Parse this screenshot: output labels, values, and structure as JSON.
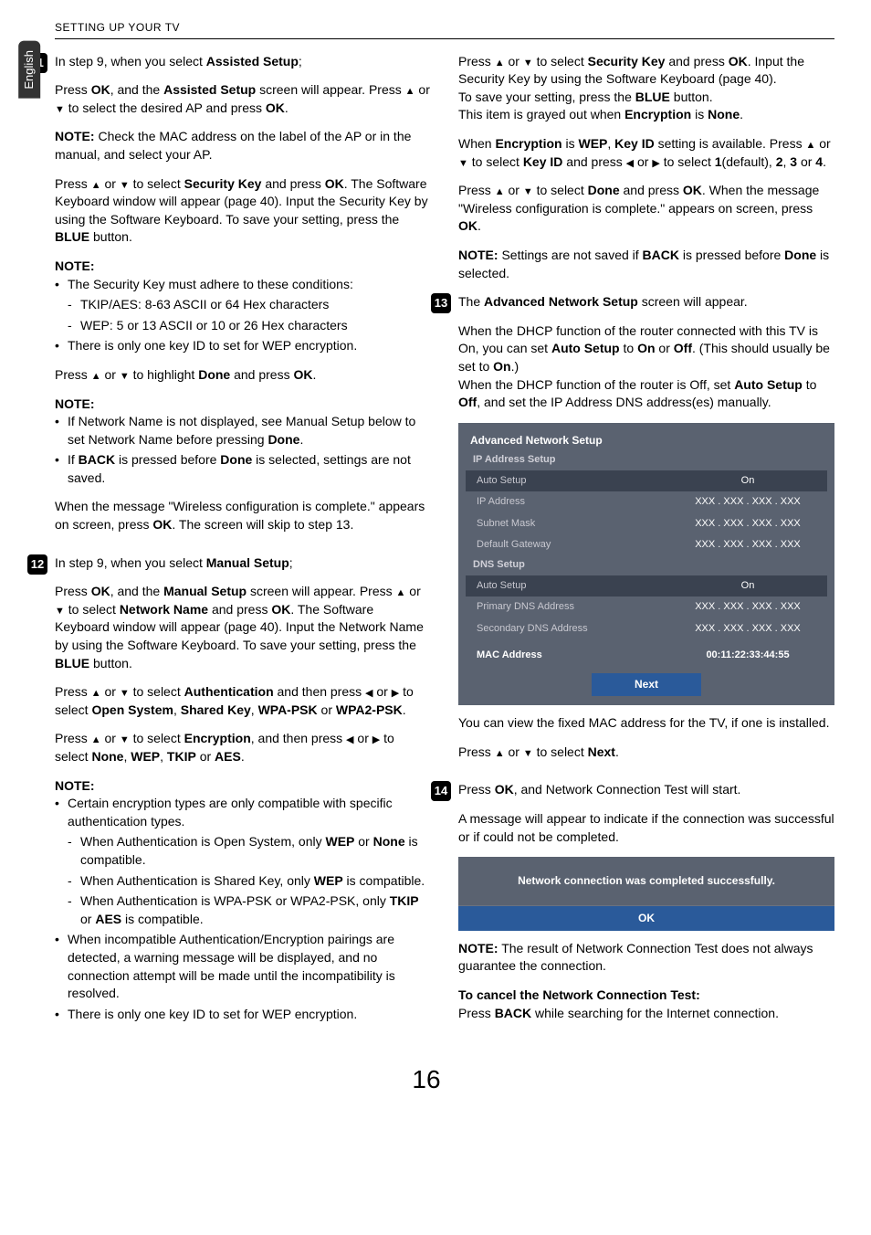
{
  "header": "SETTING UP YOUR TV",
  "langTab": "English",
  "pageNumber": "16",
  "steps": {
    "s11": "11",
    "s12": "12",
    "s13": "13",
    "s14": "14"
  },
  "col1": {
    "p1a": "In step 9, when you select ",
    "p1b": "Assisted Setup",
    "p1c": ";",
    "p2a": "Press ",
    "p2b": "OK",
    "p2c": ", and the ",
    "p2d": "Assisted Setup",
    "p2e": " screen will appear. Press ",
    "p2f": " or ",
    "p2g": " to select the desired AP and press ",
    "p2h": "OK",
    "p2i": ".",
    "p3a": "NOTE:",
    "p3b": " Check the MAC address on the label of the AP or in the manual, and select your AP.",
    "p4a": "Press ",
    "p4b": " or ",
    "p4c": " to select ",
    "p4d": "Security Key",
    "p4e": " and press ",
    "p4f": "OK",
    "p4g": ". The Software Keyboard window will appear (page 40). Input the Security Key by using the Software Keyboard. To save your setting, press the ",
    "p4h": "BLUE",
    "p4i": " button.",
    "note1": "NOTE:",
    "n1li1": "The Security Key must adhere to these conditions:",
    "n1s1": "TKIP/AES: 8-63 ASCII or 64 Hex characters",
    "n1s2": "WEP: 5 or 13 ASCII or 10 or 26 Hex characters",
    "n1li2": "There is only one key ID to set for WEP encryption.",
    "p5a": "Press ",
    "p5b": " or ",
    "p5c": " to highlight ",
    "p5d": "Done",
    "p5e": " and press ",
    "p5f": "OK",
    "p5g": ".",
    "note2": "NOTE:",
    "n2li1a": "If Network Name is not displayed, see Manual Setup below to set Network Name before pressing ",
    "n2li1b": "Done",
    "n2li1c": ".",
    "n2li2a": "If ",
    "n2li2b": "BACK",
    "n2li2c": " is pressed before ",
    "n2li2d": "Done",
    "n2li2e": " is selected, settings are not saved.",
    "p6a": "When the message \"Wireless configuration is complete.\" appears on screen, press ",
    "p6b": "OK",
    "p6c": ". The screen will skip to step 13.",
    "p7a": "In step 9, when you select ",
    "p7b": "Manual Setup",
    "p7c": ";",
    "p8a": "Press ",
    "p8b": "OK",
    "p8c": ", and the ",
    "p8d": "Manual Setup",
    "p8e": " screen will appear. Press ",
    "p8f": " or ",
    "p8g": " to select ",
    "p8h": "Network Name",
    "p8i": " and press ",
    "p8j": "OK",
    "p8k": ". The Software Keyboard window will appear (page 40). Input the Network Name by using the Software Keyboard. To save your setting, press the ",
    "p8l": "BLUE",
    "p8m": " button.",
    "p9a": "Press ",
    "p9b": " or ",
    "p9c": " to select ",
    "p9d": "Authentication",
    "p9e": " and then press ",
    "p9f": " or ",
    "p9g": " to select ",
    "p9h": "Open System",
    "p9i": ", ",
    "p9j": "Shared Key",
    "p9k": ", ",
    "p9l": "WPA-PSK",
    "p9m": " or ",
    "p9n": "WPA2-PSK",
    "p9o": ".",
    "p10a": "Press ",
    "p10b": " or ",
    "p10c": " to select ",
    "p10d": "Encryption",
    "p10e": ", and then press ",
    "p10f": " or ",
    "p10g": " to select ",
    "p10h": "None",
    "p10i": ", ",
    "p10j": "WEP",
    "p10k": ", ",
    "p10l": "TKIP",
    "p10m": " or ",
    "p10n": "AES",
    "p10o": ".",
    "note3": "NOTE:",
    "n3li1": "Certain encryption types are only compatible with specific authentication types.",
    "n3s1a": "When Authentication is Open System, only ",
    "n3s1b": "WEP",
    "n3s1c": " or ",
    "n3s1d": "None",
    "n3s1e": " is compatible.",
    "n3s2a": "When Authentication is Shared Key, only ",
    "n3s2b": "WEP",
    "n3s2c": " is compatible.",
    "n3s3a": "When Authentication is WPA-PSK or WPA2-PSK, only ",
    "n3s3b": "TKIP",
    "n3s3c": " or ",
    "n3s3d": "AES",
    "n3s3e": " is compatible.",
    "n3li2": "When incompatible Authentication/Encryption pairings are detected, a warning message will be displayed, and no connection attempt will be made until the incompatibility is resolved.",
    "n3li3": "There is only one key ID to set for WEP encryption."
  },
  "col2": {
    "p1a": "Press ",
    "p1b": " or ",
    "p1c": " to select ",
    "p1d": "Security Key",
    "p1e": " and press ",
    "p1f": "OK",
    "p1g": ". Input the Security Key by using the Software Keyboard (page 40).",
    "p1h": "To save your setting, press the ",
    "p1i": "BLUE",
    "p1j": " button.",
    "p1k": "This item is grayed out when ",
    "p1l": "Encryption",
    "p1m": " is ",
    "p1n": "None",
    "p1o": ".",
    "p2a": "When ",
    "p2b": "Encryption",
    "p2c": " is ",
    "p2d": "WEP",
    "p2e": ", ",
    "p2f": "Key ID",
    "p2g": " setting is available. Press ",
    "p2h": " or ",
    "p2i": " to select ",
    "p2j": "Key ID",
    "p2k": " and press ",
    "p2l": " or ",
    "p2m": " to select ",
    "p2n": "1",
    "p2o": "(default), ",
    "p2p": "2",
    "p2q": ", ",
    "p2r": "3",
    "p2s": " or ",
    "p2t": "4",
    "p2u": ".",
    "p3a": "Press ",
    "p3b": " or ",
    "p3c": " to select ",
    "p3d": "Done",
    "p3e": " and press ",
    "p3f": "OK",
    "p3g": ". When the message \"Wireless configuration is complete.\" appears on screen, press ",
    "p3h": "OK",
    "p3i": ".",
    "p4a": "NOTE:",
    "p4b": " Settings are not saved if ",
    "p4c": "BACK",
    "p4d": " is pressed before ",
    "p4e": "Done",
    "p4f": " is selected.",
    "p5a": "The ",
    "p5b": "Advanced Network Setup",
    "p5c": " screen will appear.",
    "p6a": "When the DHCP function of the router connected with this TV is On, you can set ",
    "p6b": "Auto Setup",
    "p6c": " to ",
    "p6d": "On",
    "p6e": " or ",
    "p6f": "Off",
    "p6g": ". (This should usually be set to ",
    "p6h": "On",
    "p6i": ".)",
    "p6j": "When the DHCP function of the router is Off, set ",
    "p6k": "Auto Setup",
    "p6l": " to ",
    "p6m": "Off",
    "p6n": ", and set the IP Address DNS address(es) manually.",
    "p7": "You can view the fixed MAC address for the TV, if one is installed.",
    "p8a": "Press ",
    "p8b": " or ",
    "p8c": " to select ",
    "p8d": "Next",
    "p8e": ".",
    "p9a": "Press ",
    "p9b": "OK",
    "p9c": ", and Network Connection Test will start.",
    "p10": "A message will appear to indicate if the connection was successful or if could not be completed.",
    "p11a": "NOTE:",
    "p11b": " The result of Network Connection Test does not always guarantee the connection.",
    "p12a": "To cancel the Network Connection Test:",
    "p12b": "Press ",
    "p12c": "BACK",
    "p12d": " while searching for the Internet connection."
  },
  "osd1": {
    "title": "Advanced Network Setup",
    "sec1": "IP Address Setup",
    "r1k": "Auto Setup",
    "r1v": "On",
    "r2k": "IP Address",
    "r2v": "XXX . XXX . XXX . XXX",
    "r3k": "Subnet Mask",
    "r3v": "XXX . XXX . XXX . XXX",
    "r4k": "Default Gateway",
    "r4v": "XXX . XXX . XXX . XXX",
    "sec2": "DNS Setup",
    "r5k": "Auto Setup",
    "r5v": "On",
    "r6k": "Primary DNS Address",
    "r6v": "XXX . XXX . XXX . XXX",
    "r7k": "Secondary DNS Address",
    "r7v": "XXX . XXX . XXX . XXX",
    "r8k": "MAC Address",
    "r8v": "00:11:22:33:44:55",
    "btn": "Next"
  },
  "osd2": {
    "msg": "Network connection was completed successfully.",
    "ok": "OK"
  }
}
